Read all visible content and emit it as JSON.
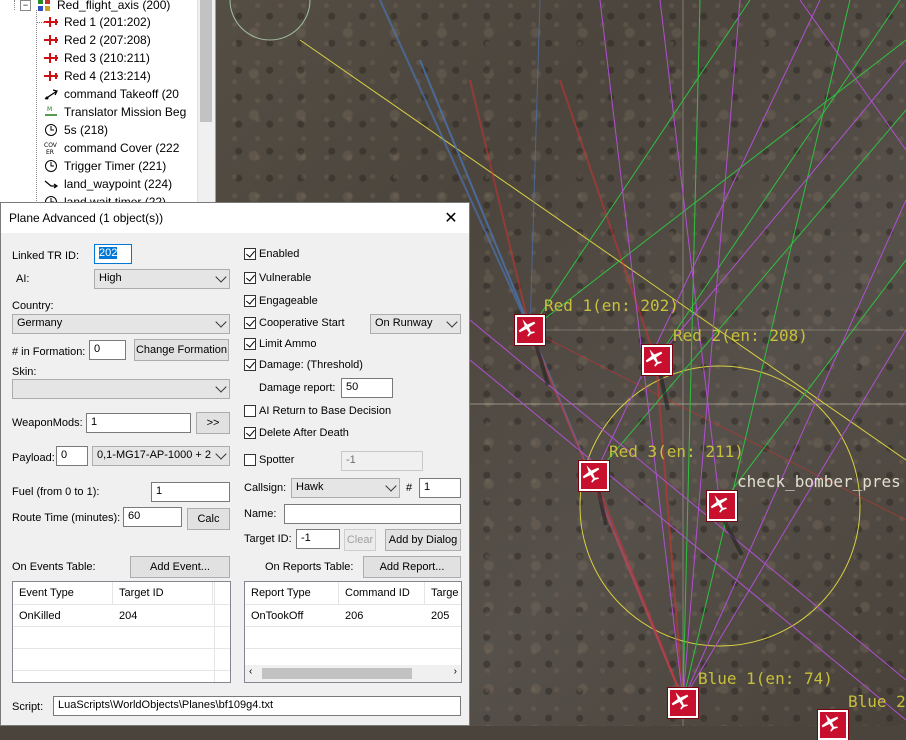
{
  "tree": {
    "root": {
      "label": "Red_flight_axis (200)",
      "icon": "group-icon"
    },
    "items": [
      {
        "label": "Red 1 (201:202)",
        "icon": "plane-icon"
      },
      {
        "label": "Red 2 (207:208)",
        "icon": "plane-icon"
      },
      {
        "label": "Red 3 (210:211)",
        "icon": "plane-icon"
      },
      {
        "label": "Red 4 (213:214)",
        "icon": "plane-icon"
      },
      {
        "label": "command Takeoff (20",
        "icon": "takeoff-icon"
      },
      {
        "label": "Translator Mission Beg",
        "icon": "translator-icon"
      },
      {
        "label": "5s (218)",
        "icon": "timer-icon"
      },
      {
        "label": "command Cover (222",
        "icon": "cover-icon",
        "icon_text": "COV\nER"
      },
      {
        "label": "Trigger Timer (221)",
        "icon": "timer-icon"
      },
      {
        "label": "land_waypoint (224)",
        "icon": "waypoint-icon"
      },
      {
        "label": "land wait timer (22)",
        "icon": "timer-icon"
      }
    ]
  },
  "dialog": {
    "title": "Plane Advanced (1 object(s))",
    "linked_tr_id": {
      "label": "Linked TR ID:",
      "value": "202"
    },
    "ai": {
      "label": "AI:",
      "value": "High"
    },
    "country": {
      "label": "Country:",
      "value": "Germany"
    },
    "formation": {
      "label": "# in Formation:",
      "value": "0",
      "button": "Change Formation"
    },
    "skin": {
      "label": "Skin:",
      "value": ""
    },
    "weaponmods": {
      "label": "WeaponMods:",
      "value": "1",
      "button": ">>"
    },
    "payload": {
      "label": "Payload:",
      "value": "0",
      "select": "0,1-MG17-AP-1000 + 2"
    },
    "fuel": {
      "label": "Fuel (from 0 to 1):",
      "value": "1"
    },
    "route_time": {
      "label": "Route Time (minutes):",
      "value": "60",
      "button": "Calc"
    },
    "enabled": {
      "label": "Enabled",
      "checked": true
    },
    "vulnerable": {
      "label": "Vulnerable",
      "checked": true
    },
    "engageable": {
      "label": "Engageable",
      "checked": true
    },
    "coop_start": {
      "label": "Cooperative Start",
      "checked": true,
      "select": "On Runway"
    },
    "limit_ammo": {
      "label": "Limit Ammo",
      "checked": true
    },
    "damage": {
      "label": "Damage: (Threshold)",
      "checked": true
    },
    "damage_report": {
      "label": "Damage report:",
      "value": "50"
    },
    "ai_return": {
      "label": "AI Return to Base Decision",
      "checked": false
    },
    "delete_after_death": {
      "label": "Delete After Death",
      "checked": true
    },
    "spotter": {
      "label": "Spotter",
      "checked": false,
      "value": "-1"
    },
    "callsign": {
      "label": "Callsign:",
      "value": "Hawk",
      "num_label": "#",
      "num": "1"
    },
    "name": {
      "label": "Name:",
      "value": ""
    },
    "target_id": {
      "label": "Target ID:",
      "value": "-1",
      "clear": "Clear",
      "add": "Add by Dialog"
    },
    "events": {
      "label": "On Events Table:",
      "button": "Add Event...",
      "columns": [
        "Event Type",
        "Target ID"
      ],
      "rows": [
        [
          "OnKilled",
          "204"
        ]
      ]
    },
    "reports": {
      "label": "On Reports Table:",
      "button": "Add Report...",
      "columns": [
        "Report Type",
        "Command ID",
        "Targe"
      ],
      "rows": [
        [
          "OnTookOff",
          "206",
          "205"
        ]
      ]
    },
    "script": {
      "label": "Script:",
      "value": "LuaScripts\\WorldObjects\\Planes\\bf109g4.txt"
    }
  },
  "map": {
    "units": [
      {
        "label": "Red 1(en: 202)",
        "color": "#c8102e"
      },
      {
        "label": "Red 2(en: 208)",
        "color": "#c8102e"
      },
      {
        "label": "Red 3(en: 211)",
        "color": "#c8102e"
      },
      {
        "label": "check_bomber_pres",
        "color": "#c8102e"
      },
      {
        "label": "Blue 1(en: 74)",
        "color": "#c8102e"
      },
      {
        "label": "Blue 2",
        "color": "#c8102e"
      }
    ],
    "label_color": "#c8c03c",
    "colors": {
      "red_line": "#d83030",
      "blue_line": "#4a7ac0",
      "green_line": "#30c040",
      "violet_line": "#b050d0",
      "circle": "#d8d040"
    }
  }
}
